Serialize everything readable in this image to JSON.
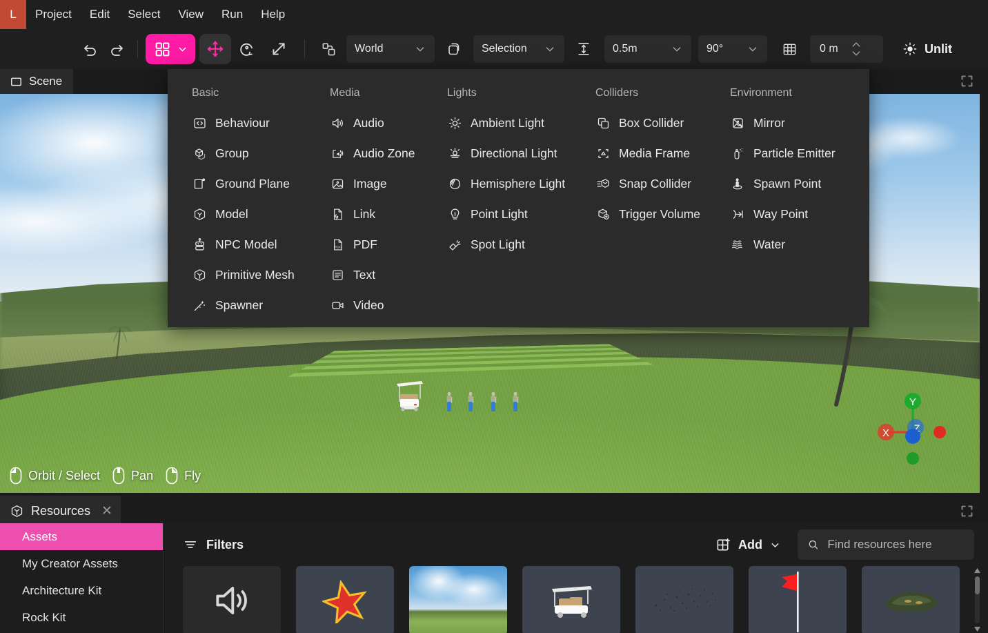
{
  "app": {
    "badge_letter": "L"
  },
  "menubar": {
    "items": [
      {
        "label": "Project"
      },
      {
        "label": "Edit"
      },
      {
        "label": "Select"
      },
      {
        "label": "View"
      },
      {
        "label": "Run"
      },
      {
        "label": "Help"
      }
    ]
  },
  "toolbar": {
    "undo_icon": "undo-icon",
    "redo_icon": "redo-icon",
    "add_tool_icon": "grid-squares-icon",
    "add_tool_chevron": "chevron-down-icon",
    "move_tool_icon": "move-arrows-icon",
    "rotate_tool_icon": "rotate-icon",
    "scale_tool_icon": "scale-arrow-icon",
    "pivot_icon": "pivot-icon",
    "space_value": "World",
    "duplicate_icon": "duplicate-shape-icon",
    "target_value": "Selection",
    "snap_ground_icon": "snap-to-ground-icon",
    "grid_size_value": "0.5m",
    "angle_snap_value": "90°",
    "grid_toggle_icon": "grid-icon",
    "height_value": "0 m",
    "stepper_up_icon": "chevron-up-icon",
    "stepper_down_icon": "chevron-down-icon",
    "lighting_icon": "brightness-icon",
    "lighting_label": "Unlit"
  },
  "scene_panel": {
    "tab_icon": "scene-rect-icon",
    "tab_label": "Scene",
    "expand_icon": "expand-icon",
    "nav_hints": [
      {
        "icon": "mouse-left-button-icon",
        "label": "Orbit / Select"
      },
      {
        "icon": "mouse-middle-button-icon",
        "label": "Pan"
      },
      {
        "icon": "mouse-right-button-icon",
        "label": "Fly"
      }
    ],
    "gizmo": {
      "x_label": "X",
      "y_label": "Y",
      "z_label": "Z",
      "x_color": "#e03b2f",
      "y_color": "#1faa2e",
      "z_color": "#2b6fd6"
    }
  },
  "add_menu": {
    "columns": [
      {
        "title": "Basic",
        "items": [
          {
            "icon": "code-brackets-icon",
            "label": "Behaviour"
          },
          {
            "icon": "group-cubes-icon",
            "label": "Group"
          },
          {
            "icon": "ground-plane-icon",
            "label": "Ground Plane"
          },
          {
            "icon": "model-hexagon-icon",
            "label": "Model"
          },
          {
            "icon": "npc-robot-icon",
            "label": "NPC Model"
          },
          {
            "icon": "primitive-cube-icon",
            "label": "Primitive Mesh"
          },
          {
            "icon": "spawner-wand-icon",
            "label": "Spawner"
          }
        ]
      },
      {
        "title": "Media",
        "items": [
          {
            "icon": "speaker-icon",
            "label": "Audio"
          },
          {
            "icon": "audio-zone-icon",
            "label": "Audio Zone"
          },
          {
            "icon": "image-icon",
            "label": "Image"
          },
          {
            "icon": "link-document-icon",
            "label": "Link"
          },
          {
            "icon": "pdf-document-icon",
            "label": "PDF"
          },
          {
            "icon": "text-lines-icon",
            "label": "Text"
          },
          {
            "icon": "video-camera-icon",
            "label": "Video"
          }
        ]
      },
      {
        "title": "Lights",
        "items": [
          {
            "icon": "ambient-light-icon",
            "label": "Ambient Light"
          },
          {
            "icon": "directional-light-icon",
            "label": "Directional Light"
          },
          {
            "icon": "hemisphere-light-icon",
            "label": "Hemisphere Light"
          },
          {
            "icon": "point-light-bulb-icon",
            "label": "Point Light"
          },
          {
            "icon": "spot-light-icon",
            "label": "Spot Light"
          }
        ]
      },
      {
        "title": "Colliders",
        "items": [
          {
            "icon": "box-collider-icon",
            "label": "Box Collider"
          },
          {
            "icon": "media-frame-icon",
            "label": "Media Frame"
          },
          {
            "icon": "snap-collider-icon",
            "label": "Snap Collider"
          },
          {
            "icon": "trigger-volume-icon",
            "label": "Trigger Volume"
          }
        ]
      },
      {
        "title": "Environment",
        "items": [
          {
            "icon": "mirror-icon",
            "label": "Mirror"
          },
          {
            "icon": "particle-emitter-icon",
            "label": "Particle Emitter"
          },
          {
            "icon": "spawn-point-icon",
            "label": "Spawn Point"
          },
          {
            "icon": "way-point-icon",
            "label": "Way Point"
          },
          {
            "icon": "water-waves-icon",
            "label": "Water"
          }
        ]
      }
    ]
  },
  "resources_panel": {
    "tab_icon": "resources-cube-icon",
    "tab_label": "Resources",
    "tab_close_icon": "close-icon",
    "expand_icon": "expand-icon",
    "sidebar": [
      {
        "label": "Assets",
        "active": true
      },
      {
        "label": "My Creator Assets",
        "active": false
      },
      {
        "label": "Architecture Kit",
        "active": false
      },
      {
        "label": "Rock Kit",
        "active": false
      }
    ],
    "filters_icon": "filters-icon",
    "filters_label": "Filters",
    "add_icon": "add-grid-icon",
    "add_label": "Add",
    "add_chevron_icon": "chevron-down-icon",
    "search_icon": "search-icon",
    "search_placeholder": "Find resources here",
    "search_value": "",
    "scroll_up_icon": "triangle-up-icon",
    "scroll_down_icon": "triangle-down-icon",
    "cards": [
      {
        "kind": "audio",
        "name": "audio-asset-thumbnail"
      },
      {
        "kind": "star",
        "name": "star-asset-thumbnail"
      },
      {
        "kind": "skybox",
        "name": "skybox-asset-thumbnail"
      },
      {
        "kind": "cart",
        "name": "golf-cart-asset-thumbnail"
      },
      {
        "kind": "particles",
        "name": "particles-asset-thumbnail"
      },
      {
        "kind": "flag",
        "name": "flag-asset-thumbnail"
      },
      {
        "kind": "rock",
        "name": "rock-asset-thumbnail"
      }
    ]
  },
  "colors": {
    "accent_pink": "#ff1ba5",
    "sidebar_active": "#ec4fad",
    "app_badge": "#c04a33",
    "panel_bg": "#2b2b2b",
    "window_bg": "#1b1b1b"
  }
}
